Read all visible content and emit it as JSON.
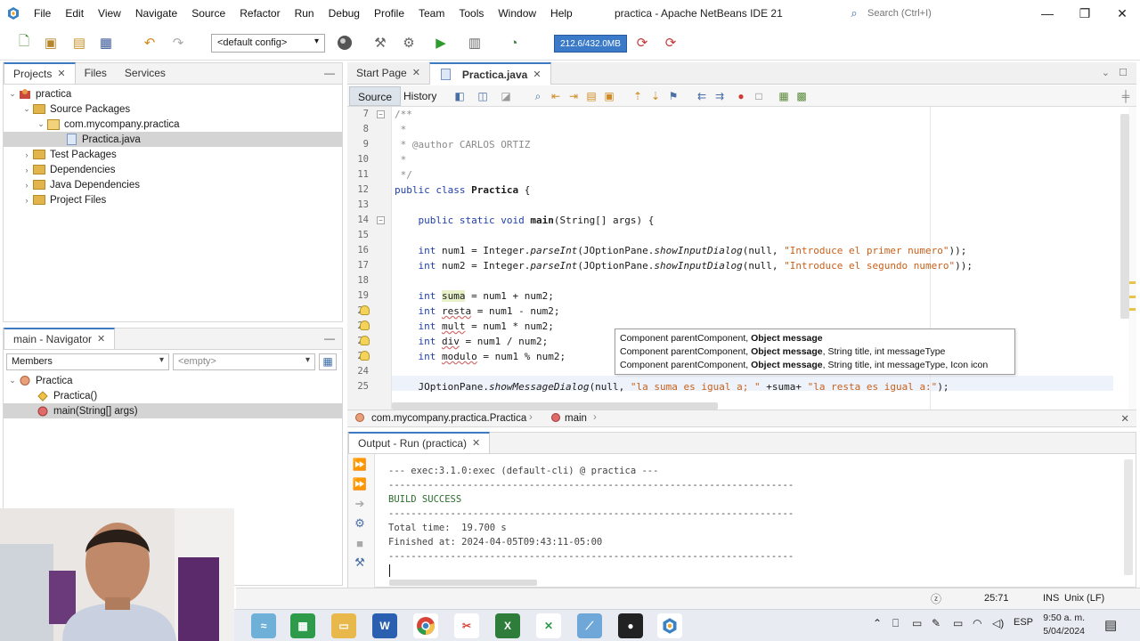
{
  "window": {
    "title": "practica - Apache NetBeans IDE 21",
    "search_placeholder": "Search (Ctrl+I)"
  },
  "menu": [
    "File",
    "Edit",
    "View",
    "Navigate",
    "Source",
    "Refactor",
    "Run",
    "Debug",
    "Profile",
    "Team",
    "Tools",
    "Window",
    "Help"
  ],
  "toolbar": {
    "config": "<default config>",
    "memory": "212.6/432.0MB"
  },
  "projects_panel": {
    "tabs": [
      "Projects",
      "Files",
      "Services"
    ],
    "tree": [
      {
        "label": "practica",
        "indent": 0,
        "icon": "project-icon",
        "selected": false
      },
      {
        "label": "Source Packages",
        "indent": 1,
        "icon": "folder-icon",
        "selected": false
      },
      {
        "label": "com.mycompany.practica",
        "indent": 2,
        "icon": "package-icon",
        "selected": false
      },
      {
        "label": "Practica.java",
        "indent": 3,
        "icon": "java-file-icon",
        "selected": true
      },
      {
        "label": "Test Packages",
        "indent": 1,
        "icon": "folder-icon",
        "selected": false
      },
      {
        "label": "Dependencies",
        "indent": 1,
        "icon": "folder-icon",
        "selected": false
      },
      {
        "label": "Java Dependencies",
        "indent": 1,
        "icon": "folder-icon",
        "selected": false
      },
      {
        "label": "Project Files",
        "indent": 1,
        "icon": "folder-icon",
        "selected": false
      }
    ]
  },
  "navigator_panel": {
    "tab": "main - Navigator",
    "filter": "Members",
    "filter2": "<empty>",
    "tree": [
      {
        "label": "Practica",
        "indent": 0,
        "selected": false
      },
      {
        "label": "Practica()",
        "indent": 1,
        "selected": false
      },
      {
        "label": "main(String[] args)",
        "indent": 1,
        "selected": true
      }
    ]
  },
  "editor": {
    "tabs": [
      "Start Page",
      "Practica.java"
    ],
    "modes": [
      "Source",
      "History"
    ],
    "line_numbers": [
      "7",
      "8",
      "9",
      "10",
      "11",
      "12",
      "13",
      "14",
      "15",
      "16",
      "17",
      "18",
      "19",
      "20",
      "21",
      "22",
      "23",
      "24",
      "25"
    ],
    "code": {
      "l7": "/**",
      "l8": " *",
      "l9": " * @author CARLOS ORTIZ",
      "l10": " *",
      "l11": " */",
      "l12a": "public class ",
      "l12b": "Practica",
      "l12c": " {",
      "l14a": "    public static void ",
      "l14b": "main",
      "l14c": "(String[] args) {",
      "l16a": "    int ",
      "l16b": "num1 = Integer.",
      "l16c": "parseInt",
      "l16d": "(JOptionPane.",
      "l16e": "showInputDialog",
      "l16f": "(null, ",
      "l16g": "\"Introduce el primer numero\"",
      "l16h": "));",
      "l17a": "    int ",
      "l17b": "num2 = Integer.",
      "l17c": "parseInt",
      "l17d": "(JOptionPane.",
      "l17e": "showInputDialog",
      "l17f": "(null, ",
      "l17g": "\"Introduce el segundo numero\"",
      "l17h": "));",
      "l19a": "    int ",
      "l19b": "suma",
      "l19c": " = num1 + num2;",
      "l20a": "    int ",
      "l20b": "resta",
      "l20c": " = num1 - num2;",
      "l21a": "    int ",
      "l21b": "mult",
      "l21c": " = num1 * num2;",
      "l22a": "    int ",
      "l22b": "div",
      "l22c": " = num1 / num2;",
      "l23a": "    int ",
      "l23b": "modulo",
      "l23c": " = num1 % num2;",
      "l25a": "    JOptionPane.",
      "l25b": "showMessageDialog",
      "l25c": "(null, ",
      "l25d": "\"la suma es igual a; \"",
      "l25e": " +suma+ ",
      "l25f": "\"la resta es igual a:\"",
      "l25g": ");"
    },
    "autocomplete": [
      {
        "pre": "Component parentComponent, ",
        "bold": "Object message",
        "post": ""
      },
      {
        "pre": "Component parentComponent, ",
        "bold": "Object message",
        "post": ", String title, int messageType"
      },
      {
        "pre": "Component parentComponent, ",
        "bold": "Object message",
        "post": ", String title, int messageType, Icon icon"
      }
    ],
    "breadcrumb": [
      "com.mycompany.practica.Practica",
      "main"
    ]
  },
  "output": {
    "tab": "Output - Run (practica)",
    "lines": [
      "--- exec:3.1.0:exec (default-cli) @ practica ---",
      "------------------------------------------------------------------------",
      "BUILD SUCCESS",
      "------------------------------------------------------------------------",
      "Total time:  19.700 s",
      "Finished at: 2024-04-05T09:43:11-05:00",
      "------------------------------------------------------------------------"
    ]
  },
  "status": {
    "position": "25:71",
    "mode": "INS",
    "line_ending": "Unix (LF)"
  },
  "taskbar": {
    "lang": "ESP",
    "time": "9:50 a. m.",
    "date": "5/04/2024"
  },
  "colors": {
    "keyword": "#1f3fa8",
    "string": "#c8601a",
    "comment": "#8a8a8a",
    "accent": "#3d7ac0"
  }
}
